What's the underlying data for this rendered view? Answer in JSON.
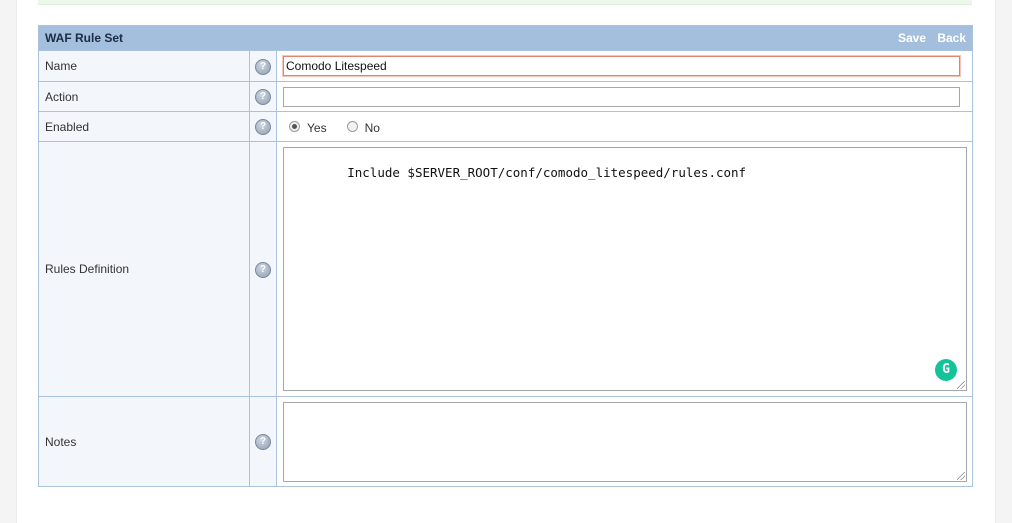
{
  "form": {
    "title": "WAF Rule Set",
    "actions": {
      "save": "Save",
      "back": "Back"
    },
    "rows": {
      "name": {
        "label": "Name",
        "value": "Comodo Litespeed"
      },
      "action": {
        "label": "Action",
        "value": ""
      },
      "enabled": {
        "label": "Enabled",
        "options": [
          "Yes",
          "No"
        ],
        "selected": "Yes"
      },
      "rules_definition": {
        "label": "Rules Definition",
        "value": "Include $SERVER_ROOT/conf/comodo_litespeed/rules.conf"
      },
      "notes": {
        "label": "Notes",
        "value": ""
      }
    }
  },
  "icons": {
    "help": "help-icon",
    "grammarly": "grammarly-icon"
  },
  "colors": {
    "header_bg": "#a3bfdd",
    "border": "#a9c3dc",
    "focus_border": "#e5836f",
    "grammarly": "#15c39a"
  }
}
